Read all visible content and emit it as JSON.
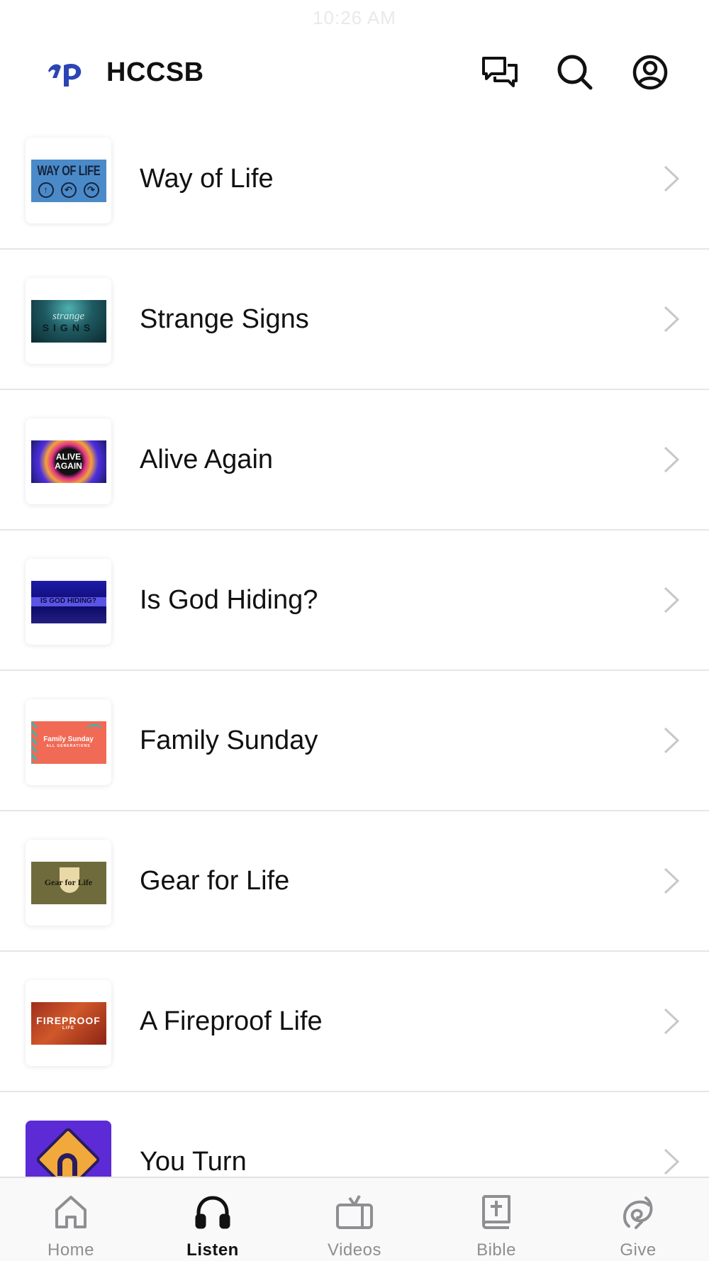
{
  "status_bar": {
    "time": "10:26 AM"
  },
  "header": {
    "title": "HCCSB",
    "icons": [
      "chat-icon",
      "search-icon",
      "account-icon"
    ]
  },
  "list": {
    "items": [
      {
        "title": "Way of Life",
        "thumb_text": "WAY OF LIFE",
        "thumb_symbols": [
          "↑",
          "↶",
          "↷"
        ]
      },
      {
        "title": "Strange Signs",
        "thumb_text": "strange",
        "thumb_subtext": "SIGNS"
      },
      {
        "title": "Alive Again",
        "thumb_text": "ALIVE",
        "thumb_subtext": "AGAIN"
      },
      {
        "title": "Is God Hiding?",
        "thumb_text": "IS GOD HIDING?"
      },
      {
        "title": "Family Sunday",
        "thumb_text": "Family Sunday",
        "thumb_subtext": "ALL GENERATIONS"
      },
      {
        "title": "Gear for Life",
        "thumb_text": "Gear for Life"
      },
      {
        "title": "A Fireproof Life",
        "thumb_text": "FIREPROOF",
        "thumb_subtext": "LIFE"
      },
      {
        "title": "You Turn"
      }
    ]
  },
  "tabbar": {
    "active": "Listen",
    "tabs": [
      {
        "label": "Home",
        "icon": "home-icon"
      },
      {
        "label": "Listen",
        "icon": "headphones-icon"
      },
      {
        "label": "Videos",
        "icon": "tv-icon"
      },
      {
        "label": "Bible",
        "icon": "bible-icon"
      },
      {
        "label": "Give",
        "icon": "give-icon"
      }
    ]
  },
  "colors": {
    "logo_blue": "#2b45b5",
    "active_tab": "#111111",
    "inactive_tab": "#8e8e93",
    "divider": "#e6e6e8",
    "chevron": "#c7c7cc"
  }
}
